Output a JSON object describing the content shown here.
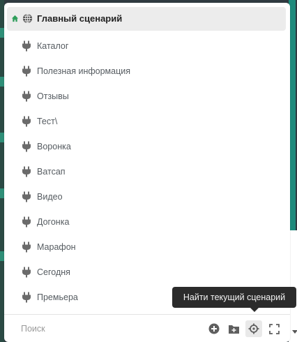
{
  "tree": {
    "root": {
      "label": "Главный сценарий",
      "icons": [
        "home-icon",
        "globe-icon"
      ]
    },
    "items": [
      {
        "label": "Каталог",
        "icon": "plug-icon"
      },
      {
        "label": "Полезная информация",
        "icon": "plug-icon"
      },
      {
        "label": "Отзывы",
        "icon": "plug-icon"
      },
      {
        "label": "Тест\\",
        "icon": "plug-icon"
      },
      {
        "label": "Воронка",
        "icon": "plug-icon"
      },
      {
        "label": "Ватсап",
        "icon": "plug-icon"
      },
      {
        "label": "Видео",
        "icon": "plug-icon"
      },
      {
        "label": "Догонка",
        "icon": "plug-icon"
      },
      {
        "label": "Марафон",
        "icon": "plug-icon"
      },
      {
        "label": "Сегодня",
        "icon": "plug-icon"
      },
      {
        "label": "Премьера",
        "icon": "plug-icon"
      }
    ]
  },
  "footer": {
    "search": {
      "placeholder": "Поиск",
      "value": ""
    },
    "tools": [
      "add-circle-icon",
      "add-folder-icon",
      "crosshair-icon",
      "fullscreen-icon"
    ]
  },
  "tooltip": {
    "text": "Найти текущий сценарий"
  },
  "colors": {
    "home_accent": "#2e9e5b",
    "icon_gray": "#6b6b6b",
    "tooltip_bg": "#2b2b2b"
  }
}
